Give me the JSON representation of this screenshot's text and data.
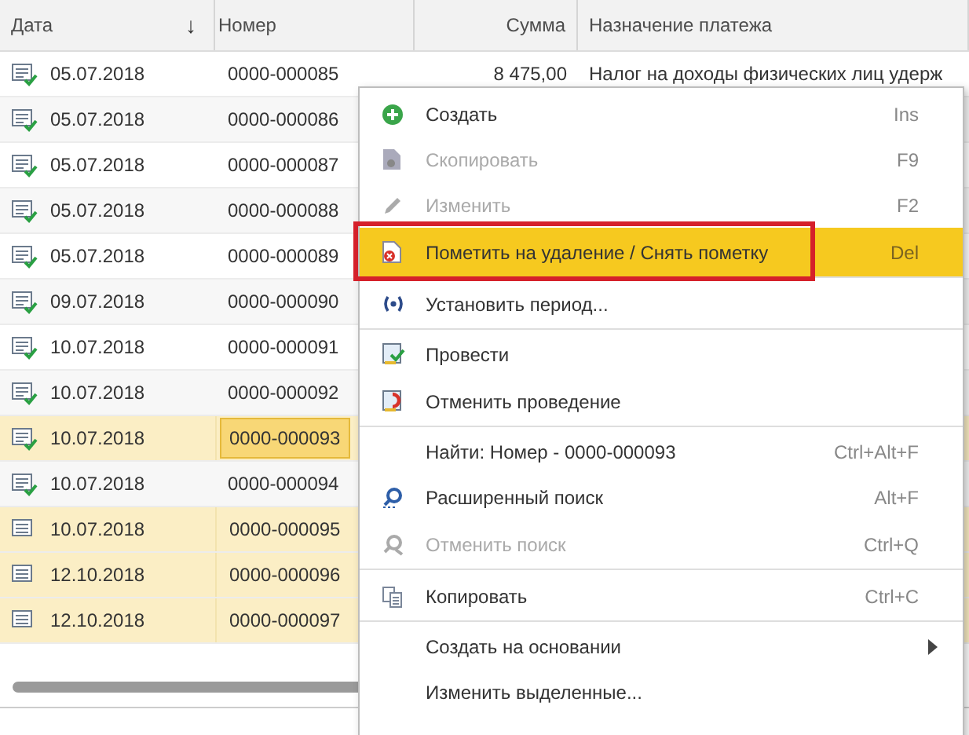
{
  "table": {
    "columns": [
      {
        "label": "Дата",
        "sort_arrow": "↓"
      },
      {
        "label": "Номер"
      },
      {
        "label": "Сумма"
      },
      {
        "label": "Назначение платежа"
      }
    ],
    "rows": [
      {
        "date": "05.07.2018",
        "number": "0000-000085",
        "sum": "8 475,00",
        "purpose": "Налог на доходы физических лиц удерж",
        "posted": true,
        "selected": false,
        "current": false
      },
      {
        "date": "05.07.2018",
        "number": "0000-000086",
        "posted": true,
        "selected": false,
        "current": false
      },
      {
        "date": "05.07.2018",
        "number": "0000-000087",
        "posted": true,
        "selected": false,
        "current": false
      },
      {
        "date": "05.07.2018",
        "number": "0000-000088",
        "posted": true,
        "selected": false,
        "current": false
      },
      {
        "date": "05.07.2018",
        "number": "0000-000089",
        "posted": true,
        "selected": false,
        "current": false
      },
      {
        "date": "09.07.2018",
        "number": "0000-000090",
        "posted": true,
        "selected": false,
        "current": false
      },
      {
        "date": "10.07.2018",
        "number": "0000-000091",
        "posted": true,
        "selected": false,
        "current": false
      },
      {
        "date": "10.07.2018",
        "number": "0000-000092",
        "posted": true,
        "selected": false,
        "current": false
      },
      {
        "date": "10.07.2018",
        "number": "0000-000093",
        "posted": true,
        "selected": true,
        "current": true
      },
      {
        "date": "10.07.2018",
        "number": "0000-000094",
        "posted": true,
        "selected": false,
        "current": false
      },
      {
        "date": "10.07.2018",
        "number": "0000-000095",
        "posted": false,
        "selected": true,
        "current": false
      },
      {
        "date": "12.10.2018",
        "number": "0000-000096",
        "posted": false,
        "selected": true,
        "current": false
      },
      {
        "date": "12.10.2018",
        "number": "0000-000097",
        "posted": false,
        "selected": true,
        "current": false
      }
    ]
  },
  "context_menu": {
    "items": [
      {
        "label": "Создать",
        "shortcut": "Ins",
        "disabled": false,
        "highlighted": false,
        "outlined": false,
        "separator_after": false
      },
      {
        "label": "Скопировать",
        "shortcut": "F9",
        "disabled": true,
        "highlighted": false,
        "outlined": false,
        "separator_after": false
      },
      {
        "label": "Изменить",
        "shortcut": "F2",
        "disabled": true,
        "highlighted": false,
        "outlined": false,
        "separator_after": false
      },
      {
        "label": "Пометить на удаление / Снять пометку",
        "shortcut": "Del",
        "disabled": false,
        "highlighted": true,
        "outlined": true,
        "separator_after": true
      },
      {
        "label": "Установить период...",
        "disabled": false,
        "highlighted": false,
        "outlined": false,
        "separator_after": true
      },
      {
        "label": "Провести",
        "disabled": false,
        "highlighted": false,
        "outlined": false,
        "separator_after": false
      },
      {
        "label": "Отменить проведение",
        "disabled": false,
        "highlighted": false,
        "outlined": false,
        "separator_after": true
      },
      {
        "label": "Найти: Номер - 0000-000093",
        "shortcut": "Ctrl+Alt+F",
        "disabled": false,
        "highlighted": false,
        "outlined": false,
        "separator_after": false
      },
      {
        "label": "Расширенный поиск",
        "shortcut": "Alt+F",
        "disabled": false,
        "highlighted": false,
        "outlined": false,
        "separator_after": false
      },
      {
        "label": "Отменить поиск",
        "shortcut": "Ctrl+Q",
        "disabled": true,
        "highlighted": false,
        "outlined": false,
        "separator_after": true
      },
      {
        "label": "Копировать",
        "shortcut": "Ctrl+C",
        "disabled": false,
        "highlighted": false,
        "outlined": false,
        "separator_after": true
      },
      {
        "label": "Создать на основании",
        "submenu": true,
        "disabled": false,
        "highlighted": false,
        "outlined": false,
        "separator_after": false
      },
      {
        "label": "Изменить выделенные...",
        "disabled": false,
        "highlighted": false,
        "outlined": false,
        "separator_after": false
      }
    ]
  }
}
